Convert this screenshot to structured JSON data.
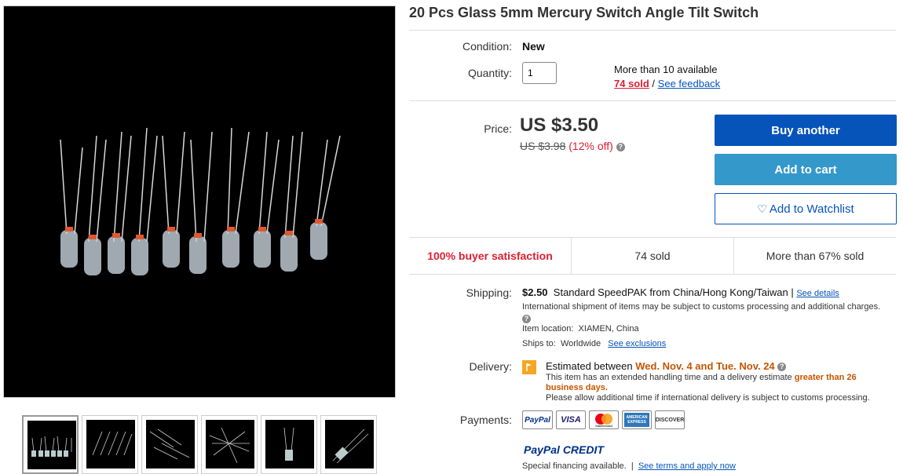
{
  "title": "20 Pcs Glass 5mm Mercury Switch Angle Tilt Switch",
  "condition": {
    "label": "Condition:",
    "value": "New"
  },
  "quantity": {
    "label": "Quantity:",
    "value": "1",
    "available": "More than 10 available",
    "sold": "74 sold",
    "separator": "/",
    "feedback": "See feedback"
  },
  "price": {
    "label": "Price:",
    "value": "US $3.50",
    "original": "US $3.98",
    "discount": "(12% off)",
    "help": "?"
  },
  "buttons": {
    "buy": "Buy another",
    "cart": "Add to cart",
    "watch": "Add to Watchlist"
  },
  "stats": [
    "100% buyer satisfaction",
    "74 sold",
    "More than 67% sold"
  ],
  "shipping": {
    "label": "Shipping:",
    "cost": "$2.50",
    "method": "Standard SpeedPAK from China/Hong Kong/Taiwan |",
    "details": "See details",
    "note": "International shipment of items may be subject to customs processing and additional charges.",
    "help": "?",
    "location_label": "Item location:",
    "location": "XIAMEN, China",
    "ships_label": "Ships to:",
    "ships": "Worldwide",
    "exclusions": "See exclusions"
  },
  "delivery": {
    "label": "Delivery:",
    "estimated": "Estimated between",
    "dates": "Wed. Nov. 4 and Tue. Nov. 24",
    "help": "?",
    "note1": "This item has an extended handling time and a delivery estimate",
    "note_hl": "greater than 26 business days.",
    "note2": "Please allow additional time if international delivery is subject to customs processing."
  },
  "payments": {
    "label": "Payments:",
    "methods": [
      "PayPal",
      "VISA",
      "mastercard",
      "AMERICAN EXPRESS",
      "DISCOVER"
    ],
    "credit": "PayPal CREDIT",
    "financing": "Special financing available.",
    "sep": "|",
    "terms": "See terms and apply now"
  },
  "colors": {
    "primary": "#0654ba",
    "cart": "#3498ca",
    "red": "#dd1e31",
    "orange": "#c55500"
  }
}
